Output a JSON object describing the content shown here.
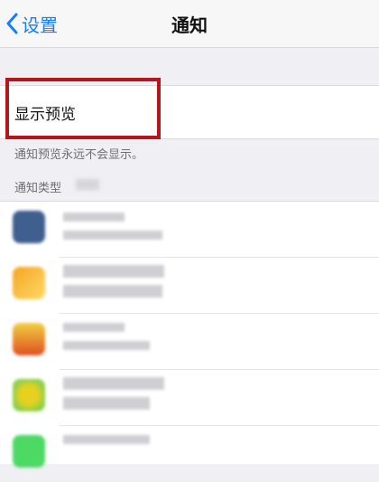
{
  "navbar": {
    "back_label": "设置",
    "title": "通知",
    "accent_color": "#157efb"
  },
  "preview": {
    "label": "显示预览",
    "value": "",
    "footnote": "通知预览永远不会显示。"
  },
  "section": {
    "header": "通知类型"
  },
  "apps": [
    {
      "icon_color": "#3f5f8f"
    },
    {
      "icon_color": "#f5a623"
    },
    {
      "icon_color": "#e0b020"
    },
    {
      "icon_color": "#9acd32"
    },
    {
      "icon_color": "#4cd964"
    }
  ],
  "highlight_color": "#b3161d"
}
